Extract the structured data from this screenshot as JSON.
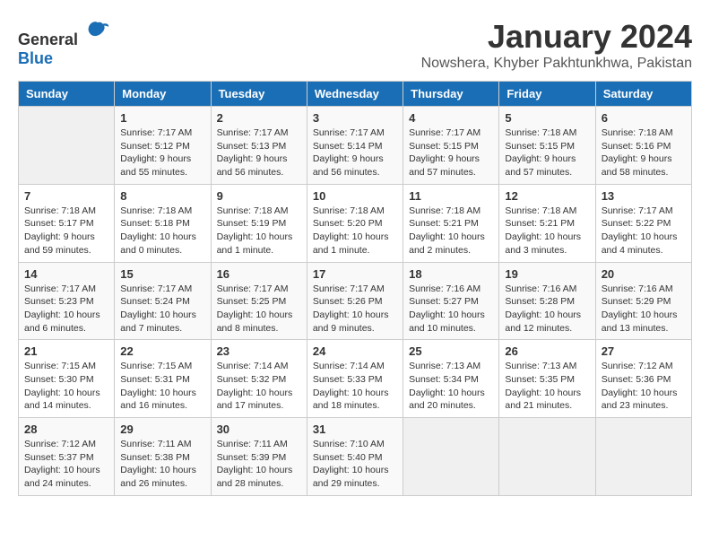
{
  "logo": {
    "general": "General",
    "blue": "Blue"
  },
  "title": "January 2024",
  "subtitle": "Nowshera, Khyber Pakhtunkhwa, Pakistan",
  "headers": [
    "Sunday",
    "Monday",
    "Tuesday",
    "Wednesday",
    "Thursday",
    "Friday",
    "Saturday"
  ],
  "weeks": [
    [
      {
        "num": "",
        "empty": true
      },
      {
        "num": "1",
        "sunrise": "Sunrise: 7:17 AM",
        "sunset": "Sunset: 5:12 PM",
        "daylight": "Daylight: 9 hours and 55 minutes."
      },
      {
        "num": "2",
        "sunrise": "Sunrise: 7:17 AM",
        "sunset": "Sunset: 5:13 PM",
        "daylight": "Daylight: 9 hours and 56 minutes."
      },
      {
        "num": "3",
        "sunrise": "Sunrise: 7:17 AM",
        "sunset": "Sunset: 5:14 PM",
        "daylight": "Daylight: 9 hours and 56 minutes."
      },
      {
        "num": "4",
        "sunrise": "Sunrise: 7:17 AM",
        "sunset": "Sunset: 5:15 PM",
        "daylight": "Daylight: 9 hours and 57 minutes."
      },
      {
        "num": "5",
        "sunrise": "Sunrise: 7:18 AM",
        "sunset": "Sunset: 5:15 PM",
        "daylight": "Daylight: 9 hours and 57 minutes."
      },
      {
        "num": "6",
        "sunrise": "Sunrise: 7:18 AM",
        "sunset": "Sunset: 5:16 PM",
        "daylight": "Daylight: 9 hours and 58 minutes."
      }
    ],
    [
      {
        "num": "7",
        "sunrise": "Sunrise: 7:18 AM",
        "sunset": "Sunset: 5:17 PM",
        "daylight": "Daylight: 9 hours and 59 minutes."
      },
      {
        "num": "8",
        "sunrise": "Sunrise: 7:18 AM",
        "sunset": "Sunset: 5:18 PM",
        "daylight": "Daylight: 10 hours and 0 minutes."
      },
      {
        "num": "9",
        "sunrise": "Sunrise: 7:18 AM",
        "sunset": "Sunset: 5:19 PM",
        "daylight": "Daylight: 10 hours and 1 minute."
      },
      {
        "num": "10",
        "sunrise": "Sunrise: 7:18 AM",
        "sunset": "Sunset: 5:20 PM",
        "daylight": "Daylight: 10 hours and 1 minute."
      },
      {
        "num": "11",
        "sunrise": "Sunrise: 7:18 AM",
        "sunset": "Sunset: 5:21 PM",
        "daylight": "Daylight: 10 hours and 2 minutes."
      },
      {
        "num": "12",
        "sunrise": "Sunrise: 7:18 AM",
        "sunset": "Sunset: 5:21 PM",
        "daylight": "Daylight: 10 hours and 3 minutes."
      },
      {
        "num": "13",
        "sunrise": "Sunrise: 7:17 AM",
        "sunset": "Sunset: 5:22 PM",
        "daylight": "Daylight: 10 hours and 4 minutes."
      }
    ],
    [
      {
        "num": "14",
        "sunrise": "Sunrise: 7:17 AM",
        "sunset": "Sunset: 5:23 PM",
        "daylight": "Daylight: 10 hours and 6 minutes."
      },
      {
        "num": "15",
        "sunrise": "Sunrise: 7:17 AM",
        "sunset": "Sunset: 5:24 PM",
        "daylight": "Daylight: 10 hours and 7 minutes."
      },
      {
        "num": "16",
        "sunrise": "Sunrise: 7:17 AM",
        "sunset": "Sunset: 5:25 PM",
        "daylight": "Daylight: 10 hours and 8 minutes."
      },
      {
        "num": "17",
        "sunrise": "Sunrise: 7:17 AM",
        "sunset": "Sunset: 5:26 PM",
        "daylight": "Daylight: 10 hours and 9 minutes."
      },
      {
        "num": "18",
        "sunrise": "Sunrise: 7:16 AM",
        "sunset": "Sunset: 5:27 PM",
        "daylight": "Daylight: 10 hours and 10 minutes."
      },
      {
        "num": "19",
        "sunrise": "Sunrise: 7:16 AM",
        "sunset": "Sunset: 5:28 PM",
        "daylight": "Daylight: 10 hours and 12 minutes."
      },
      {
        "num": "20",
        "sunrise": "Sunrise: 7:16 AM",
        "sunset": "Sunset: 5:29 PM",
        "daylight": "Daylight: 10 hours and 13 minutes."
      }
    ],
    [
      {
        "num": "21",
        "sunrise": "Sunrise: 7:15 AM",
        "sunset": "Sunset: 5:30 PM",
        "daylight": "Daylight: 10 hours and 14 minutes."
      },
      {
        "num": "22",
        "sunrise": "Sunrise: 7:15 AM",
        "sunset": "Sunset: 5:31 PM",
        "daylight": "Daylight: 10 hours and 16 minutes."
      },
      {
        "num": "23",
        "sunrise": "Sunrise: 7:14 AM",
        "sunset": "Sunset: 5:32 PM",
        "daylight": "Daylight: 10 hours and 17 minutes."
      },
      {
        "num": "24",
        "sunrise": "Sunrise: 7:14 AM",
        "sunset": "Sunset: 5:33 PM",
        "daylight": "Daylight: 10 hours and 18 minutes."
      },
      {
        "num": "25",
        "sunrise": "Sunrise: 7:13 AM",
        "sunset": "Sunset: 5:34 PM",
        "daylight": "Daylight: 10 hours and 20 minutes."
      },
      {
        "num": "26",
        "sunrise": "Sunrise: 7:13 AM",
        "sunset": "Sunset: 5:35 PM",
        "daylight": "Daylight: 10 hours and 21 minutes."
      },
      {
        "num": "27",
        "sunrise": "Sunrise: 7:12 AM",
        "sunset": "Sunset: 5:36 PM",
        "daylight": "Daylight: 10 hours and 23 minutes."
      }
    ],
    [
      {
        "num": "28",
        "sunrise": "Sunrise: 7:12 AM",
        "sunset": "Sunset: 5:37 PM",
        "daylight": "Daylight: 10 hours and 24 minutes."
      },
      {
        "num": "29",
        "sunrise": "Sunrise: 7:11 AM",
        "sunset": "Sunset: 5:38 PM",
        "daylight": "Daylight: 10 hours and 26 minutes."
      },
      {
        "num": "30",
        "sunrise": "Sunrise: 7:11 AM",
        "sunset": "Sunset: 5:39 PM",
        "daylight": "Daylight: 10 hours and 28 minutes."
      },
      {
        "num": "31",
        "sunrise": "Sunrise: 7:10 AM",
        "sunset": "Sunset: 5:40 PM",
        "daylight": "Daylight: 10 hours and 29 minutes."
      },
      {
        "num": "",
        "empty": true
      },
      {
        "num": "",
        "empty": true
      },
      {
        "num": "",
        "empty": true
      }
    ]
  ]
}
